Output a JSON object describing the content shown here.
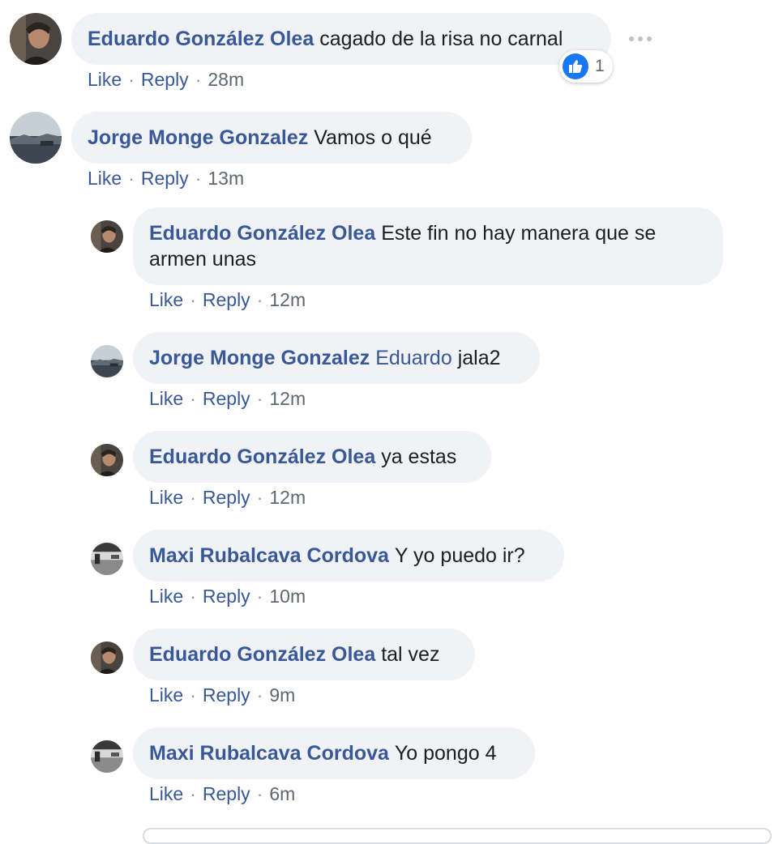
{
  "comments": [
    {
      "author": "Eduardo González Olea",
      "text": "cagado de la risa no carnal",
      "actions": {
        "like": "Like",
        "reply": "Reply",
        "sep": "·",
        "time": "28m"
      },
      "reaction_count": "1"
    },
    {
      "author": "Jorge Monge Gonzalez",
      "text": "Vamos o qué",
      "actions": {
        "like": "Like",
        "reply": "Reply",
        "sep": "·",
        "time": "13m"
      }
    }
  ],
  "replies": [
    {
      "author": "Eduardo González Olea",
      "text": "Este fin no hay manera que se",
      "text2": "armen unas",
      "actions": {
        "like": "Like",
        "reply": "Reply",
        "sep": "·",
        "time": "12m"
      }
    },
    {
      "author": "Jorge Monge Gonzalez",
      "mention": "Eduardo",
      "text": "jala2",
      "actions": {
        "like": "Like",
        "reply": "Reply",
        "sep": "·",
        "time": "12m"
      }
    },
    {
      "author": "Eduardo González Olea",
      "text": "ya estas",
      "actions": {
        "like": "Like",
        "reply": "Reply",
        "sep": "·",
        "time": "12m"
      }
    },
    {
      "author": "Maxi Rubalcava Cordova",
      "text": "Y yo puedo ir?",
      "actions": {
        "like": "Like",
        "reply": "Reply",
        "sep": "·",
        "time": "10m"
      }
    },
    {
      "author": "Eduardo González Olea",
      "text": "tal vez",
      "actions": {
        "like": "Like",
        "reply": "Reply",
        "sep": "·",
        "time": "9m"
      }
    },
    {
      "author": "Maxi Rubalcava Cordova",
      "text": "Yo pongo 4",
      "actions": {
        "like": "Like",
        "reply": "Reply",
        "sep": "·",
        "time": "6m"
      }
    }
  ],
  "colors": {
    "link": "#385898",
    "bubble": "#f0f2f5",
    "like_badge": "#1877f2",
    "meta": "#606770"
  },
  "icons": {
    "more": "more-horizontal-icon",
    "like_reaction": "thumbs-up-icon"
  }
}
